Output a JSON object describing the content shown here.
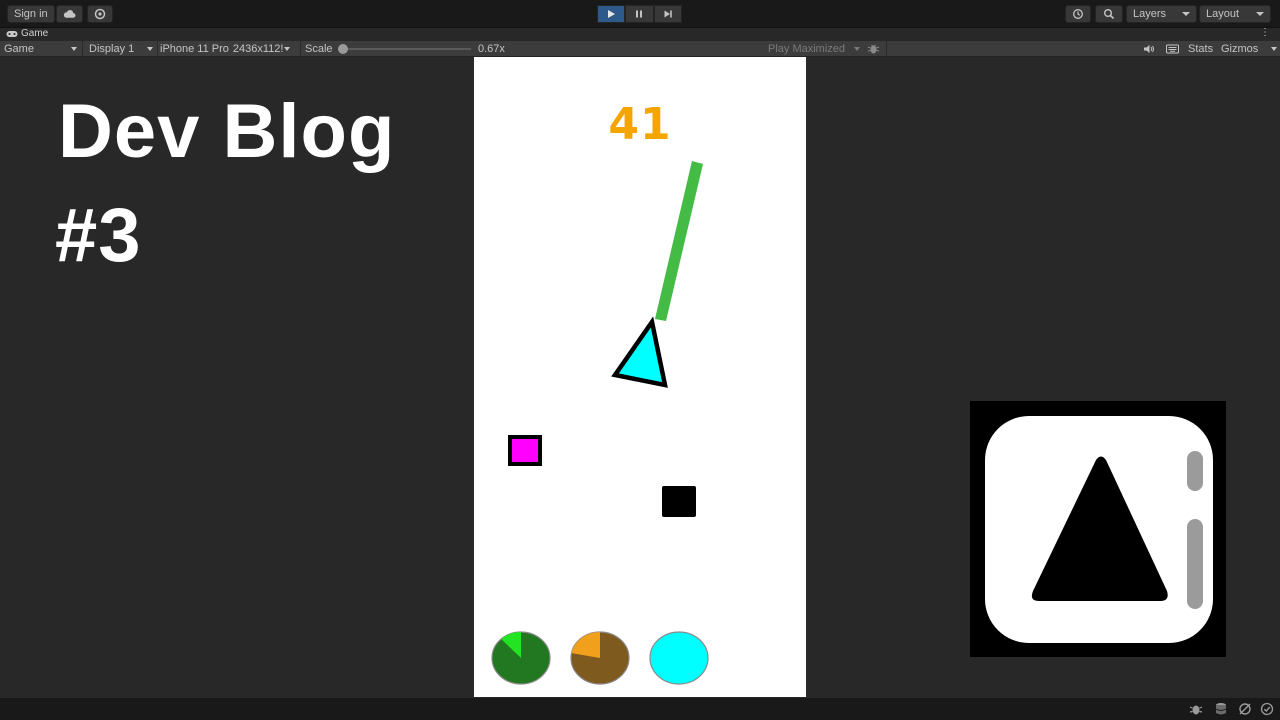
{
  "toolbar": {
    "sign_in_label": "Sign in",
    "cloud_icon": "cloud-icon",
    "collab_icon": "collab-icon",
    "play_icon": "play-icon",
    "pause_icon": "pause-icon",
    "step_icon": "step-icon",
    "history_icon": "history-icon",
    "search_icon": "search-icon",
    "layers_label": "Layers",
    "layout_label": "Layout",
    "play_active": true
  },
  "tab": {
    "label": "Game",
    "icon": "gamepad-icon"
  },
  "game_toolbar": {
    "view_mode": "Game",
    "display": "Display 1",
    "device": "iPhone 11 Pro",
    "resolution": "2436x112!",
    "scale_label": "Scale",
    "scale_value": "0.67x",
    "scale_fraction": 0.0,
    "play_mode": "Play Maximized",
    "stats_label": "Stats",
    "gizmos_label": "Gizmos"
  },
  "overlay": {
    "line1": "Dev Blog",
    "line2": "#3"
  },
  "game": {
    "score": "41",
    "colors": {
      "score": "#f5a500",
      "beam": "#44bb44",
      "player": "#00ffff",
      "pickup": "#ff00ff",
      "obstacle": "#000000"
    },
    "cooldowns": [
      {
        "name": "green-ability",
        "base": "#217821",
        "fill": "#22e422",
        "fraction": 0.12
      },
      {
        "name": "orange-ability",
        "base": "#7f5a1f",
        "fill": "#f0a01a",
        "fraction": 0.22
      },
      {
        "name": "cyan-ability",
        "base": "#00ffff",
        "fill": "#00ffff",
        "fraction": 1.0
      }
    ]
  },
  "app_icon": {
    "name": "triangle-app-icon",
    "background": "#000000",
    "card": "#ffffff"
  }
}
